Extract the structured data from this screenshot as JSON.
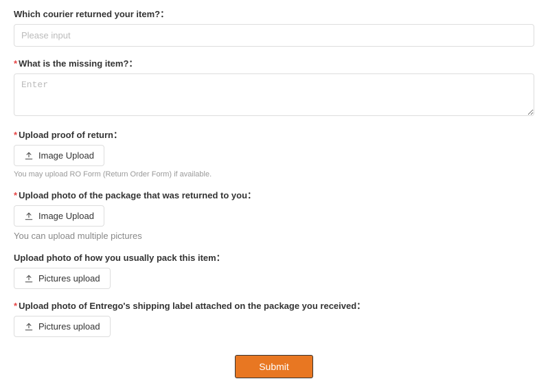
{
  "fields": {
    "courier": {
      "label": "Which courier returned your item?：",
      "placeholder": "Please input",
      "required": false
    },
    "missing": {
      "label": "What is the missing item?：",
      "placeholder": "Enter",
      "required": true
    },
    "proof": {
      "label": "Upload proof of return：",
      "button": "Image Upload",
      "hint": "You may upload RO Form (Return Order Form) if available.",
      "required": true
    },
    "package_returned": {
      "label": "Upload photo of the package that was returned to you：",
      "button": "Image Upload",
      "hint": "You can upload multiple pictures",
      "required": true
    },
    "pack_usual": {
      "label": "Upload photo of how you usually pack this item：",
      "button": "Pictures upload",
      "required": false
    },
    "shipping_label": {
      "label": "Upload photo of Entrego's shipping label attached on the package you received：",
      "button": "Pictures upload",
      "required": true
    }
  },
  "submit_label": "Submit",
  "required_mark": "*"
}
